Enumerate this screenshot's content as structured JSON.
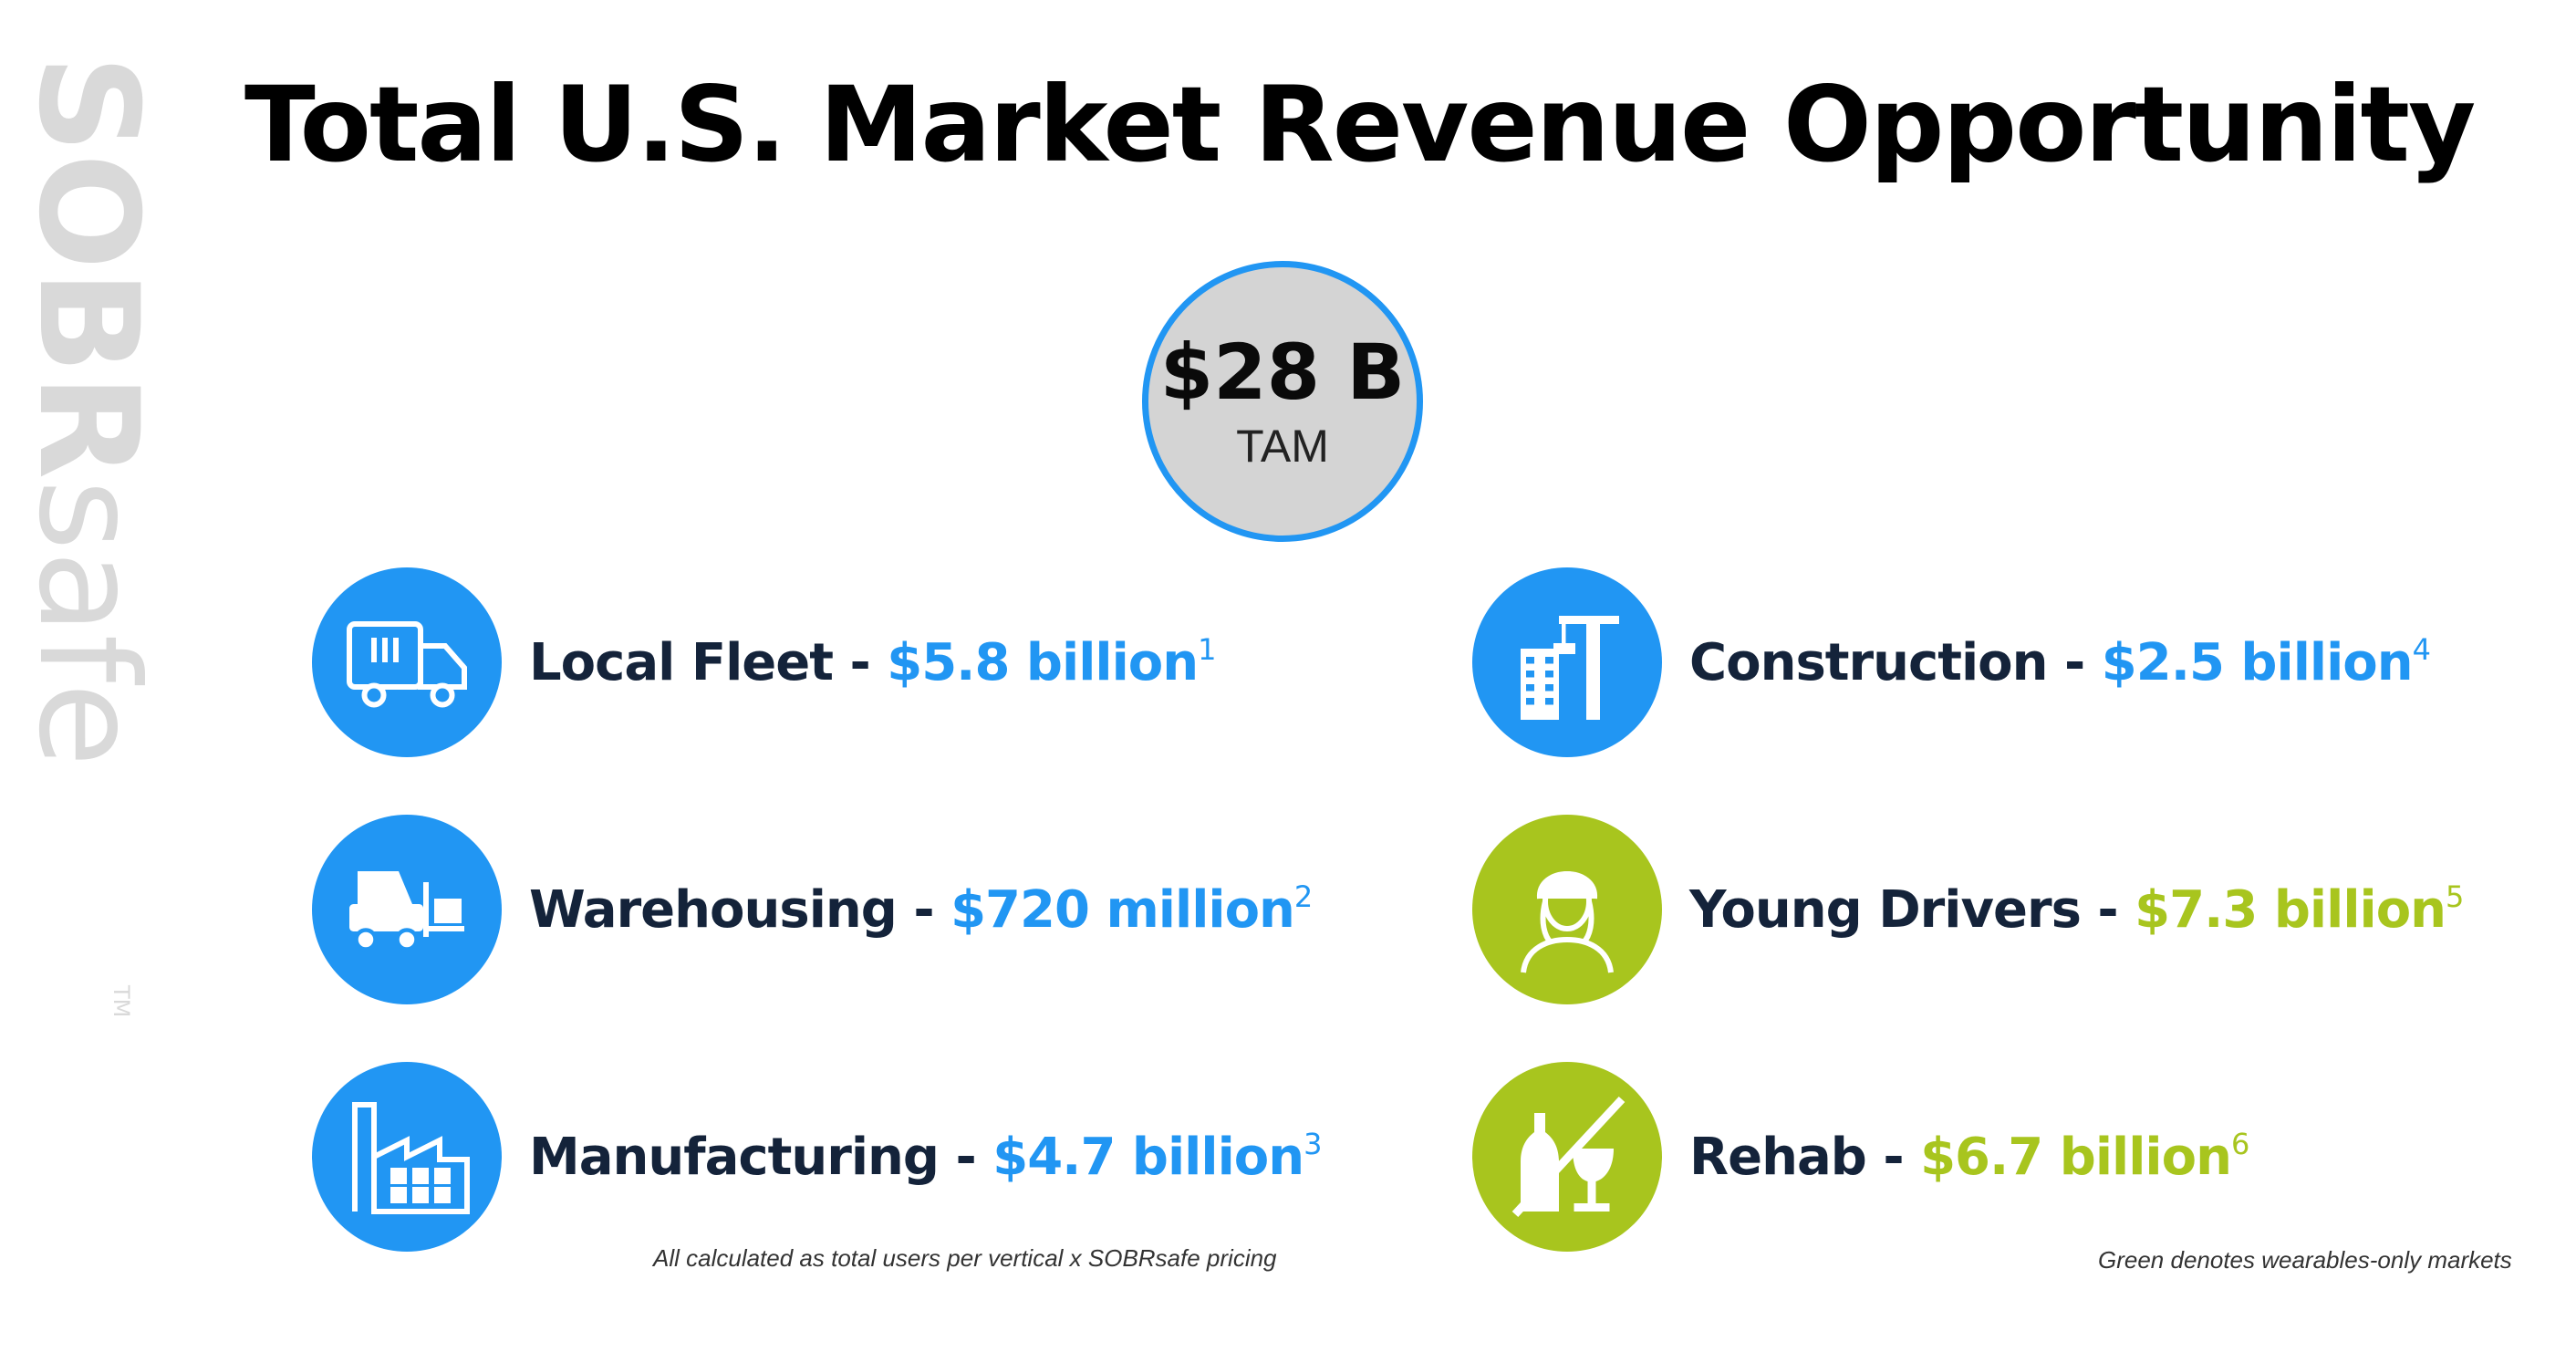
{
  "title": "Total U.S. Market Revenue Opportunity",
  "brand": {
    "logo_text": "SOBRsafe",
    "trademark": "TM"
  },
  "tam": {
    "value": "$28 B",
    "label": "TAM"
  },
  "markets": [
    {
      "name": "Local Fleet",
      "sep": " - ",
      "value": "$5.8 billion",
      "ref": "1",
      "color": "#2196f3",
      "icon": "delivery-truck-icon"
    },
    {
      "name": "Warehousing",
      "sep": " - ",
      "value": "$720 million",
      "ref": "2",
      "color": "#2196f3",
      "icon": "forklift-icon"
    },
    {
      "name": "Manufacturing",
      "sep": " - ",
      "value": "$4.7 billion",
      "ref": "3",
      "color": "#2196f3",
      "icon": "factory-icon"
    },
    {
      "name": "Construction",
      "sep": " - ",
      "value": "$2.5 billion",
      "ref": "4",
      "color": "#2196f3",
      "icon": "crane-building-icon"
    },
    {
      "name": "Young Drivers",
      "sep": " - ",
      "value": "$7.3 billion",
      "ref": "5",
      "color": "#a8c51e",
      "icon": "young-person-icon"
    },
    {
      "name": "Rehab",
      "sep": " - ",
      "value": "$6.7 billion",
      "ref": "6",
      "color": "#a8c51e",
      "icon": "no-alcohol-icon"
    }
  ],
  "notes": {
    "calc": "All calculated as total users per vertical x SOBRsafe pricing",
    "green": "Green denotes wearables-only markets"
  }
}
